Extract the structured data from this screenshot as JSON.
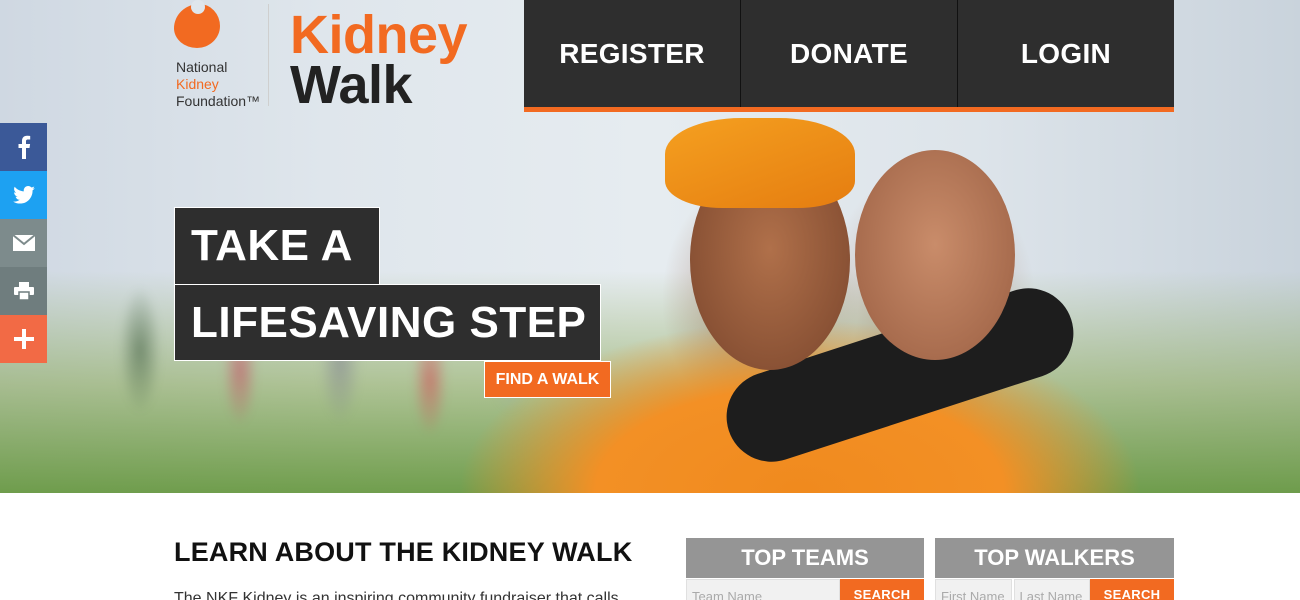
{
  "brand": {
    "nkf_line1": "National",
    "nkf_line2": "Kidney",
    "nkf_line3": "Foundation™",
    "title_line1": "Kidney",
    "title_line2": "Walk",
    "accent_color": "#f26a21",
    "dark_color": "#2e2e2e"
  },
  "nav": {
    "items": [
      {
        "label": "REGISTER"
      },
      {
        "label": "DONATE"
      },
      {
        "label": "LOGIN"
      }
    ]
  },
  "social": {
    "items": [
      {
        "icon": "facebook-icon",
        "color": "#3b5998"
      },
      {
        "icon": "twitter-icon",
        "color": "#1da1f2"
      },
      {
        "icon": "email-icon",
        "color": "#7d8b8c"
      },
      {
        "icon": "print-icon",
        "color": "#6f7d7e"
      },
      {
        "icon": "plus-icon",
        "color": "#f26a45"
      }
    ]
  },
  "hero": {
    "headline_line1": "TAKE A",
    "headline_line2": "LIFESAVING STEP",
    "cta_label": "FIND A WALK"
  },
  "learn": {
    "title": "LEARN ABOUT THE KIDNEY WALK",
    "body": "The NKF Kidney is an inspiring community fundraiser that calls"
  },
  "top_teams": {
    "title": "TOP TEAMS",
    "placeholder": "Team Name",
    "button": "SEARCH"
  },
  "top_walkers": {
    "title": "TOP WALKERS",
    "first_placeholder": "First Name",
    "last_placeholder": "Last Name",
    "button": "SEARCH"
  }
}
